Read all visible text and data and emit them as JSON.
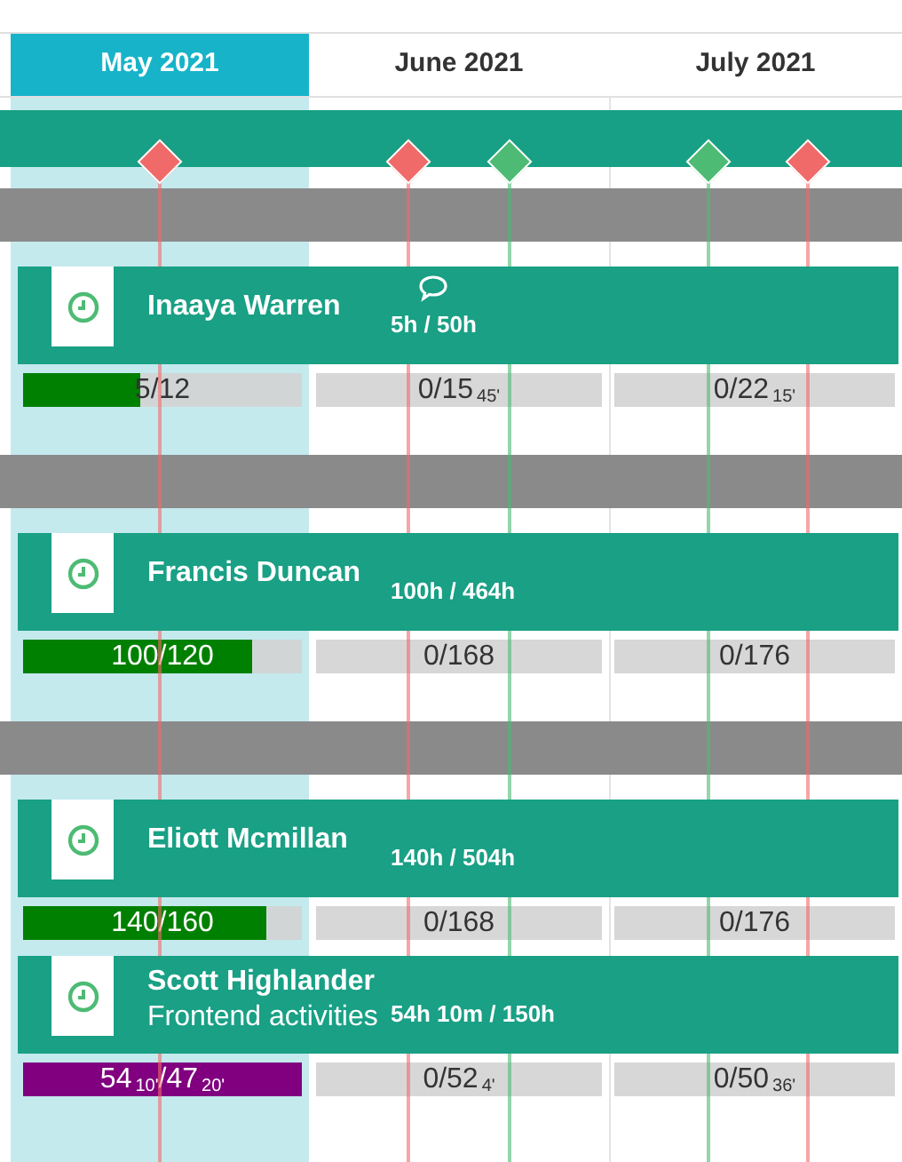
{
  "months": [
    {
      "label": "May 2021",
      "selected": true
    },
    {
      "label": "June 2021",
      "selected": false
    },
    {
      "label": "July 2021",
      "selected": false
    }
  ],
  "milestones": [
    {
      "color": "#f06a6a"
    },
    {
      "color": "#f06a6a"
    },
    {
      "color": "#4dbb74"
    },
    {
      "color": "#4dbb74"
    },
    {
      "color": "#f06a6a"
    }
  ],
  "people": [
    {
      "name": "Inaaya Warren",
      "comment": true,
      "divider_bar": true,
      "hours": "5h / 50h",
      "cells": [
        {
          "text": "5/12",
          "level": 0.42,
          "color": "#008000"
        },
        {
          "text": "0/15$_{45'}$"
        },
        {
          "text": "0/22$_{15'}$"
        }
      ]
    },
    {
      "name": "Francis Duncan",
      "comment": false,
      "divider_bar": true,
      "hours": "100h / 464h",
      "cells": [
        {
          "text": "100/120",
          "level": 0.82,
          "color": "#008000"
        },
        {
          "text": "0/168"
        },
        {
          "text": "0/176"
        }
      ]
    },
    {
      "name": "Eliott Mcmillan",
      "comment": false,
      "divider_bar": true,
      "hours": "140h / 504h",
      "cells": [
        {
          "text": "140/160",
          "level": 0.87,
          "color": "#008000"
        },
        {
          "text": "0/168"
        },
        {
          "text": "0/176"
        }
      ]
    },
    {
      "name": "Scott Highlander",
      "subtitle": "Frontend activities",
      "comment": false,
      "divider_bar": false,
      "hours": "54h 10m / 150h",
      "cells": [
        {
          "text": "54$_{10'}$/47$_{20'}$",
          "color": "#800080"
        },
        {
          "text": "0/52$_{4'}$"
        },
        {
          "text": "0/50$_{36'}$"
        }
      ]
    }
  ]
}
